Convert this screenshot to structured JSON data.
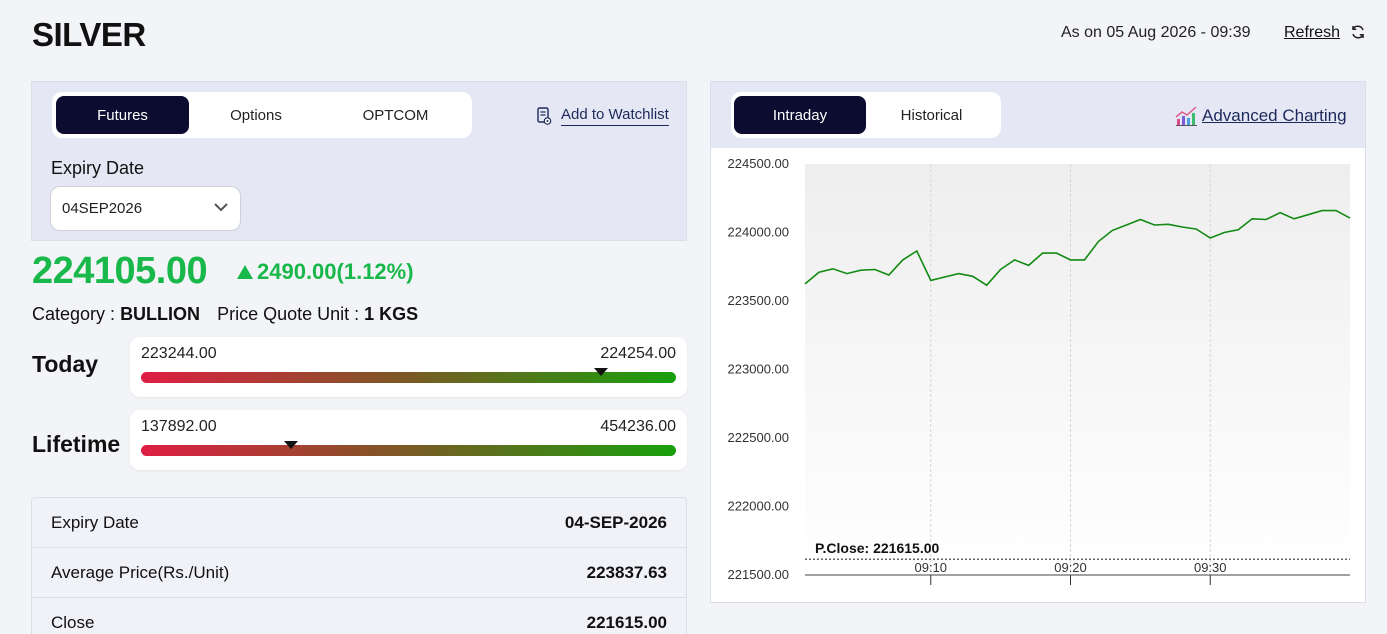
{
  "header": {
    "title": "SILVER",
    "as_on": "As on 05 Aug 2026 - 09:39",
    "refresh_label": "Refresh"
  },
  "tabs": [
    {
      "label": "Futures",
      "active": true
    },
    {
      "label": "Options",
      "active": false
    },
    {
      "label": "OPTCOM",
      "active": false
    }
  ],
  "watchlist_label": "Add to Watchlist",
  "expiry": {
    "label": "Expiry Date",
    "value": "04SEP2026"
  },
  "quote": {
    "price": "224105.00",
    "change": "2490.00(1.12%)"
  },
  "info": {
    "category_label": "Category :",
    "category_value": "BULLION",
    "unit_label": "Price Quote Unit :",
    "unit_value": "1 KGS"
  },
  "today": {
    "label": "Today",
    "low": "223244.00",
    "high": "224254.00",
    "position": 0.86
  },
  "lifetime": {
    "label": "Lifetime",
    "low": "137892.00",
    "high": "454236.00",
    "position": 0.28
  },
  "details": [
    {
      "label": "Expiry Date",
      "value": "04-SEP-2026"
    },
    {
      "label": "Average Price(Rs./Unit)",
      "value": "223837.63"
    },
    {
      "label": "Close",
      "value": "221615.00"
    }
  ],
  "chart_tabs": [
    {
      "label": "Intraday",
      "active": true
    },
    {
      "label": "Historical",
      "active": false
    }
  ],
  "advanced_label": "Advanced Charting",
  "colors": {
    "up": "#19b84a",
    "line": "#138a13",
    "dark": "#0b0c30"
  },
  "chart_data": {
    "type": "line",
    "x": [
      "09:01",
      "09:02",
      "09:03",
      "09:04",
      "09:05",
      "09:06",
      "09:07",
      "09:08",
      "09:09",
      "09:10",
      "09:11",
      "09:12",
      "09:13",
      "09:14",
      "09:15",
      "09:16",
      "09:17",
      "09:18",
      "09:19",
      "09:20",
      "09:21",
      "09:22",
      "09:23",
      "09:24",
      "09:25",
      "09:26",
      "09:27",
      "09:28",
      "09:29",
      "09:30",
      "09:31",
      "09:32",
      "09:33",
      "09:34",
      "09:35",
      "09:36",
      "09:37",
      "09:38",
      "09:39",
      "09:40"
    ],
    "values": [
      223625,
      223710,
      223735,
      223700,
      223725,
      223730,
      223690,
      223800,
      223865,
      223650,
      223675,
      223700,
      223680,
      223615,
      223730,
      223800,
      223760,
      223850,
      223850,
      223800,
      223800,
      223935,
      224015,
      224055,
      224095,
      224055,
      224060,
      224040,
      224025,
      223960,
      224000,
      224020,
      224100,
      224095,
      224145,
      224100,
      224130,
      224160,
      224160,
      224105
    ],
    "x_ticks": [
      "09:10",
      "09:20",
      "09:30"
    ],
    "y_ticks": [
      "224500.00",
      "224000.00",
      "223500.00",
      "223000.00",
      "222500.00",
      "222000.00",
      "221500.00"
    ],
    "ylim": [
      221500,
      224500
    ],
    "reference": {
      "label": "P.Close: 221615.00",
      "value": 221615
    },
    "grid": true
  }
}
